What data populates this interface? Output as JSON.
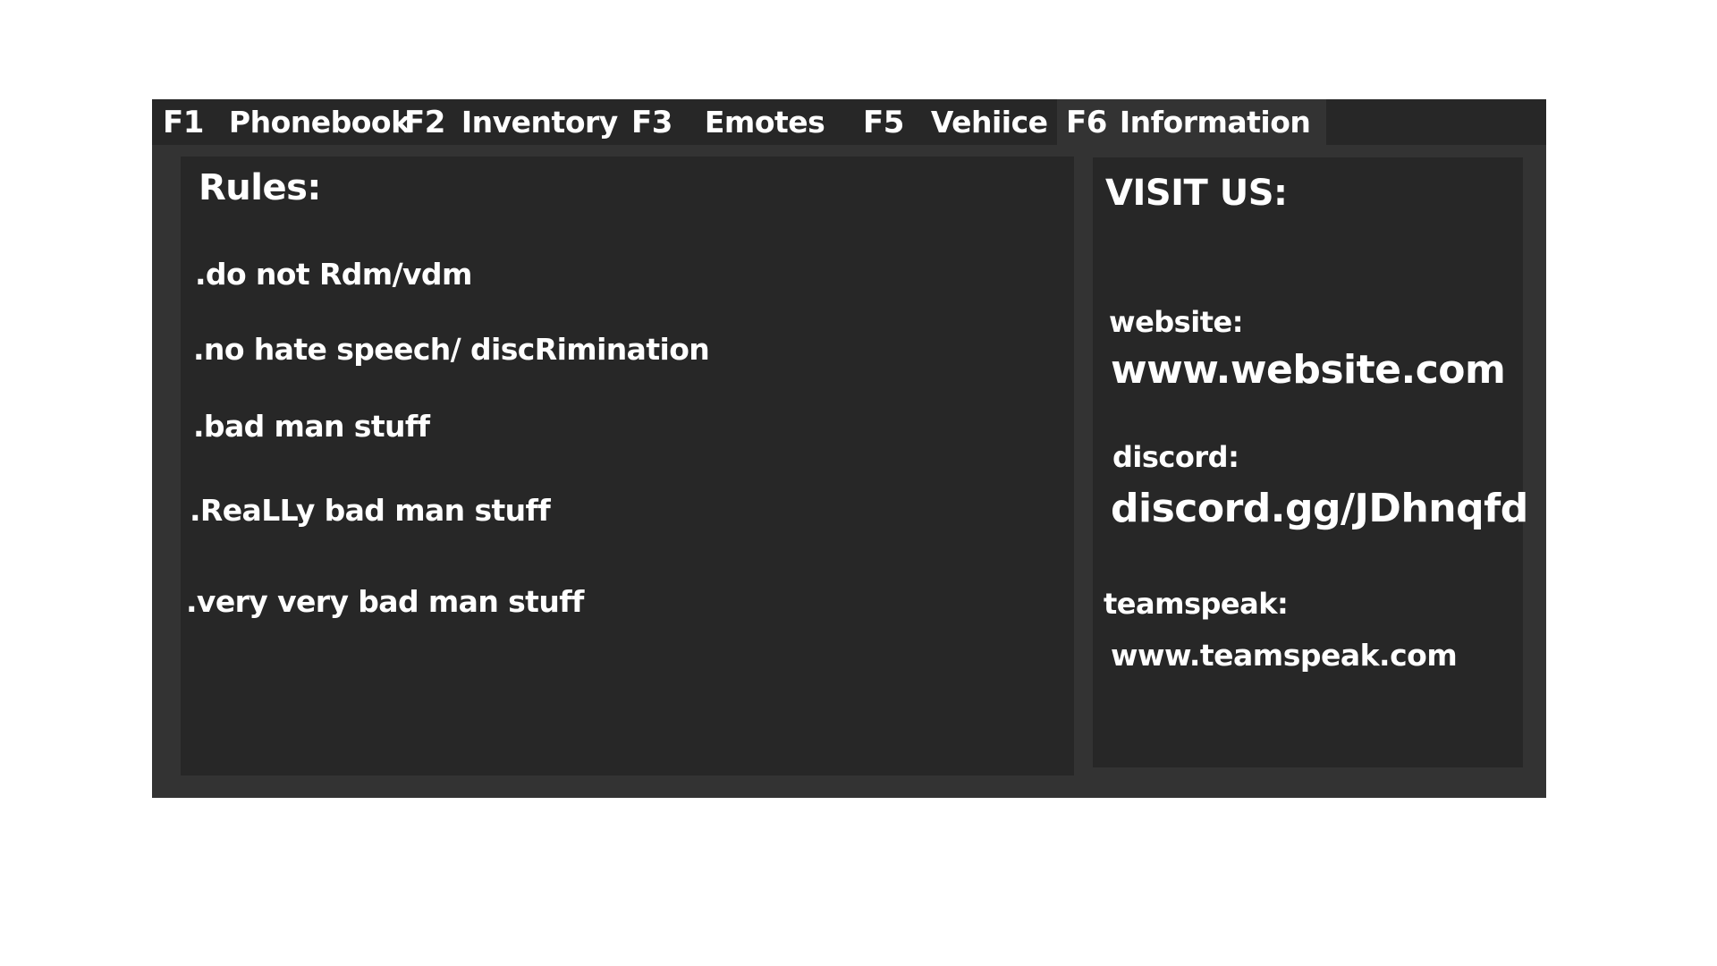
{
  "tabs": [
    {
      "key": "F1",
      "label": "Phonebook",
      "active": false
    },
    {
      "key": "F2",
      "label": "Inventory",
      "active": false
    },
    {
      "key": "F3",
      "label": "Emotes",
      "active": false
    },
    {
      "key": "F5",
      "label": "Vehiice",
      "active": false
    },
    {
      "key": "F6",
      "label": "Information",
      "active": true
    }
  ],
  "rules": {
    "title": "Rules:",
    "items": [
      ".do not Rdm/vdm",
      ".no hate speech/ discRimination",
      ".bad man stuff",
      ".ReaLLy bad man stuff",
      ".very very bad man stuff"
    ]
  },
  "visit": {
    "title": "VISIT US:",
    "website_label": "website:",
    "website_value": "www.website.com",
    "discord_label": "discord:",
    "discord_value": "discord.gg/JDhnqfd",
    "teamspeak_label": "teamspeak:",
    "teamspeak_value": "www.teamspeak.com"
  },
  "colors": {
    "background": "#ffffff",
    "panel": "#333333",
    "tabbar": "#272727",
    "content_box": "#272727",
    "text": "#ffffff"
  }
}
